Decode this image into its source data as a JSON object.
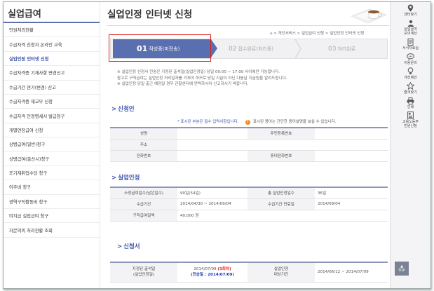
{
  "sidebar": {
    "title": "실업급여",
    "items": [
      {
        "label": "민원처리현황"
      },
      {
        "label": "수급자격 신청자 온라인 교육"
      },
      {
        "label": "실업인정 인터넷 신청"
      },
      {
        "label": "수급자격증 기재사항 변경신고"
      },
      {
        "label": "수급기간 연기(변경) 신고"
      },
      {
        "label": "수급자격증 재교부 신청"
      },
      {
        "label": "수급자격 인정명세서 발급청구"
      },
      {
        "label": "개별연장급여 신청"
      },
      {
        "label": "상병급여(일반)청구"
      },
      {
        "label": "상병급여(출산시)청구"
      },
      {
        "label": "조기재취업수당 청구"
      },
      {
        "label": "이주비 청구"
      },
      {
        "label": "광역구직활동비 청구"
      },
      {
        "label": "미지급 실업급여 청구"
      },
      {
        "label": "자문의의 처리현황 조회"
      }
    ]
  },
  "rightbar": {
    "items": [
      {
        "label": "센터찾기",
        "icon": "location-pin-icon"
      },
      {
        "label": "실업급여\n모의계산",
        "icon": "person-icon"
      },
      {
        "label": "서식자료실",
        "icon": "document-icon"
      },
      {
        "label": "이용문의",
        "icon": "speech-bubble-icon"
      },
      {
        "label": "개선제안",
        "icon": "lightbulb-icon"
      },
      {
        "label": "즐겨찾기",
        "icon": "star-icon"
      },
      {
        "label": "인쇄",
        "icon": "printer-icon"
      },
      {
        "label": "고용노동부\n민원신청",
        "icon": "form-icon"
      }
    ],
    "top_label": "TOP"
  },
  "main": {
    "title": "실업인정 인터넷 신청",
    "breadcrumb": "⌂ > 개인서비스 > 실업급여 신청 > 실업인정 인터넷 신청",
    "steps": [
      {
        "num": "01",
        "label": "작성중(미전송)"
      },
      {
        "num": "02",
        "label": "접수완료(처리중)"
      },
      {
        "num": "03",
        "label": "처리완료"
      }
    ],
    "notice": [
      "※ 실업인정 신청서 전송은 지정된 출석일(실업인정일) 당일 09:00 ~ 17:00 사이에만 가능합니다.",
      "   참고로 구직급여는 실업인정 처리일자를 거쳐야 하므로 당일 지급이 아닌 다음날 지급됨을 알려드립니다.",
      "※ 실업인정 당일 출근 예정일 경우 관할센터에 연락하시어 신고하시기 바랍니다."
    ],
    "applicant": {
      "heading": "신청인",
      "legend_required": "* 표시된 부분은 필수 입력사항입니다.",
      "legend_help": "표시된 용어는 간단한 용어설명을 보실 수 있습니다.",
      "rows": [
        {
          "l1": "성명",
          "v1": "",
          "l2": "주민등록번호",
          "v2": ""
        },
        {
          "l1": "주소",
          "v1": "",
          "l2": "",
          "v2": ""
        },
        {
          "l1": "전화번호",
          "v1": "",
          "l2": "휴대전화번호",
          "v2": ""
        }
      ]
    },
    "recognition": {
      "heading": "실업인정",
      "rows": [
        {
          "l1": "소정급여일수(남은일수)",
          "v1": "90일(54일)",
          "l2": "총 실업인정일수",
          "v2": "36일"
        },
        {
          "l1": "수급기간",
          "v1": "2014/04/30 ~ 2014/09/04",
          "l2": "수급기간 만료일",
          "v2": "2014/09/04"
        },
        {
          "l1": "구직급여일액",
          "v1": "40,000 원",
          "l2": "",
          "v2": ""
        }
      ]
    },
    "application": {
      "heading": "신청서",
      "date_label_1": "지정된 출석일",
      "date_label_2": "(실업인정일)",
      "date_value": "2014/07/09",
      "round": "(3회차)",
      "sent": "(전송일 : 2014/07/09)",
      "period_label_1": "실업인정",
      "period_label_2": "대상기간",
      "period_value": "2014/06/12 ~ 2014/07/09"
    }
  },
  "colors": {
    "accent": "#5a6fb0",
    "highlight": "#e0221f",
    "link": "#3c55a8"
  }
}
